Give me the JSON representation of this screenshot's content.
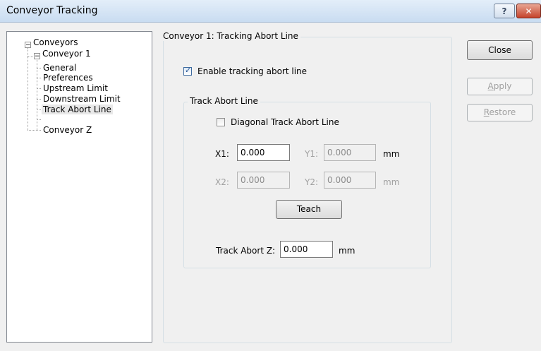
{
  "window": {
    "title": "Conveyor Tracking",
    "help_glyph": "?",
    "close_glyph": "✕"
  },
  "tree": {
    "root": {
      "label": "Conveyors",
      "expander": "−"
    },
    "conveyor1": {
      "label": "Conveyor 1",
      "expander": "−"
    },
    "children": [
      "General",
      "Preferences",
      "Upstream Limit",
      "Downstream Limit",
      "Track Abort Line"
    ],
    "selected": "Track Abort Line",
    "conveyor_z": "Conveyor Z"
  },
  "panel": {
    "legend": "Conveyor 1: Tracking Abort Line",
    "enable_checkbox": {
      "label": "Enable tracking abort line",
      "checked": true
    },
    "group": {
      "legend": "Track Abort Line",
      "diagonal_checkbox": {
        "label": "Diagonal Track Abort Line",
        "checked": false
      },
      "x1": {
        "label": "X1:",
        "value": "0.000"
      },
      "y1": {
        "label": "Y1:",
        "value": "0.000"
      },
      "x2": {
        "label": "X2:",
        "value": "0.000"
      },
      "y2": {
        "label": "Y2:",
        "value": "0.000"
      },
      "unit_row1": "mm",
      "unit_row2": "mm",
      "teach_label": "Teach",
      "track_abort_z": {
        "label": "Track Abort Z:",
        "value": "0.000",
        "unit": "mm"
      }
    }
  },
  "buttons": {
    "close": "Close",
    "apply": {
      "accel": "A",
      "rest": "pply"
    },
    "restore": {
      "accel": "R",
      "rest": "estore"
    }
  }
}
